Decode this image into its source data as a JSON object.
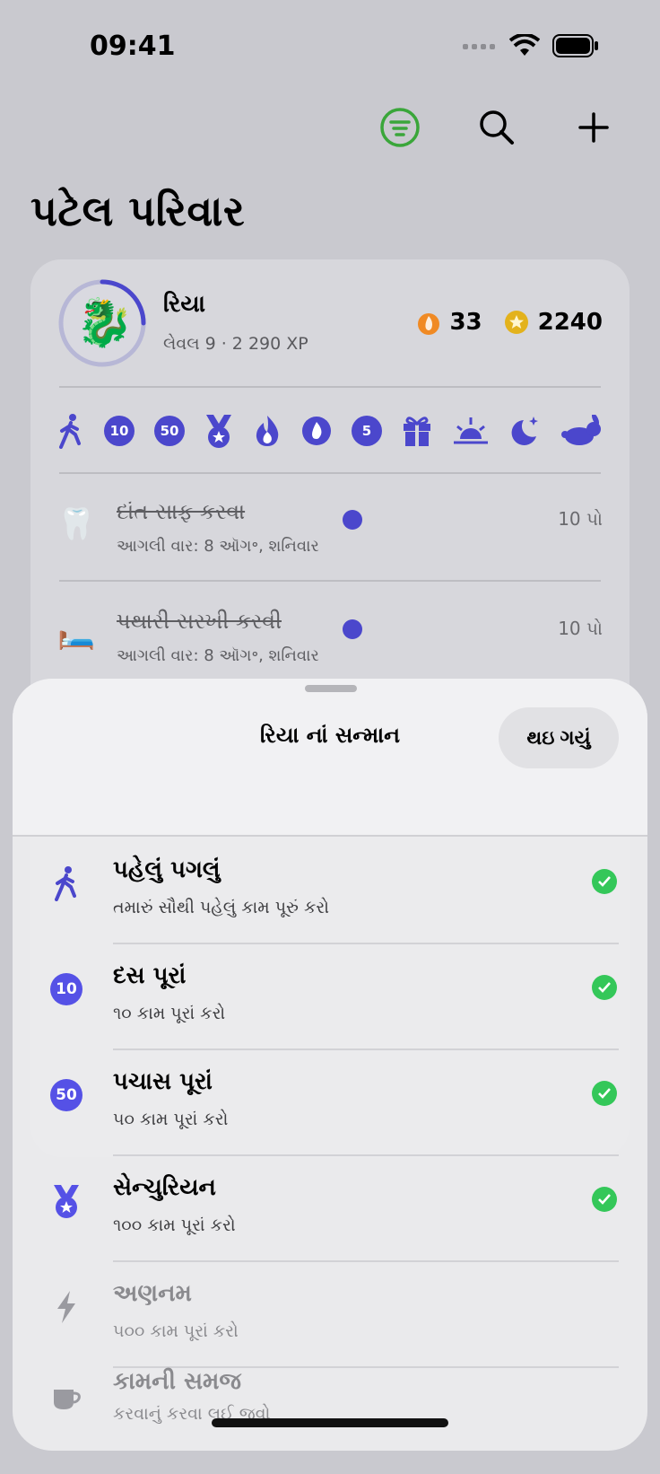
{
  "status_bar": {
    "time": "09:41"
  },
  "header": {
    "title": "પટેલ પરિવાર"
  },
  "profile": {
    "name": "રિયા",
    "subtitle": "લેવલ 9 · 2 290 XP",
    "streak": "33",
    "coins": "2240",
    "level_progress": 0.25,
    "avatar_emoji": "🐉"
  },
  "badges": [
    "walk-icon",
    "10",
    "50",
    "medal-icon",
    "flame-icon",
    "flame-circle-icon",
    "5",
    "gift-icon",
    "sunrise-icon",
    "moon-stars-icon",
    "rabbit-icon"
  ],
  "tasks": [
    {
      "emoji": "🦷",
      "title": "દાંત સાફ કરવા",
      "subtitle": "આગલી વાર: 8 ઑગ॰, શનિવાર",
      "points": "10 પો"
    },
    {
      "emoji": "🛏️",
      "title": "પથારી સરખી કરવી",
      "subtitle": "આગલી વાર: 8 ઑગ॰, શનિવાર",
      "points": "10 પો"
    }
  ],
  "sheet": {
    "title": "રિયા નાં સન્માન",
    "done_label": "થઇ ગયું",
    "achievements": [
      {
        "icon": "walk-icon",
        "title": "પહેલું પગલું",
        "subtitle": "તમારું સૌથી પહેલું કામ પૂરું કરો",
        "unlocked": true
      },
      {
        "icon": "10",
        "title": "દસ પૂરાં",
        "subtitle": "૧૦ કામ પૂરાં કરો",
        "unlocked": true
      },
      {
        "icon": "50",
        "title": "પચાસ પૂરાં",
        "subtitle": "૫૦ કામ પૂરાં કરો",
        "unlocked": true
      },
      {
        "icon": "medal-icon",
        "title": "સેન્ચુરિયન",
        "subtitle": "૧૦૦ કામ પૂરાં કરો",
        "unlocked": true
      },
      {
        "icon": "bolt-icon",
        "title": "અણનમ",
        "subtitle": "૫૦૦ કામ પૂરાં કરો",
        "unlocked": false
      },
      {
        "icon": "cup-icon",
        "title": "કામની સમજ",
        "subtitle": "કરવાનું કરવા લઈ જવો",
        "unlocked": false
      }
    ]
  },
  "colors": {
    "accent": "#4b47cc",
    "check_green": "#34c759",
    "flame": "#f08a24",
    "coin": "#e3b21c",
    "filter_green": "#3aa63a"
  }
}
